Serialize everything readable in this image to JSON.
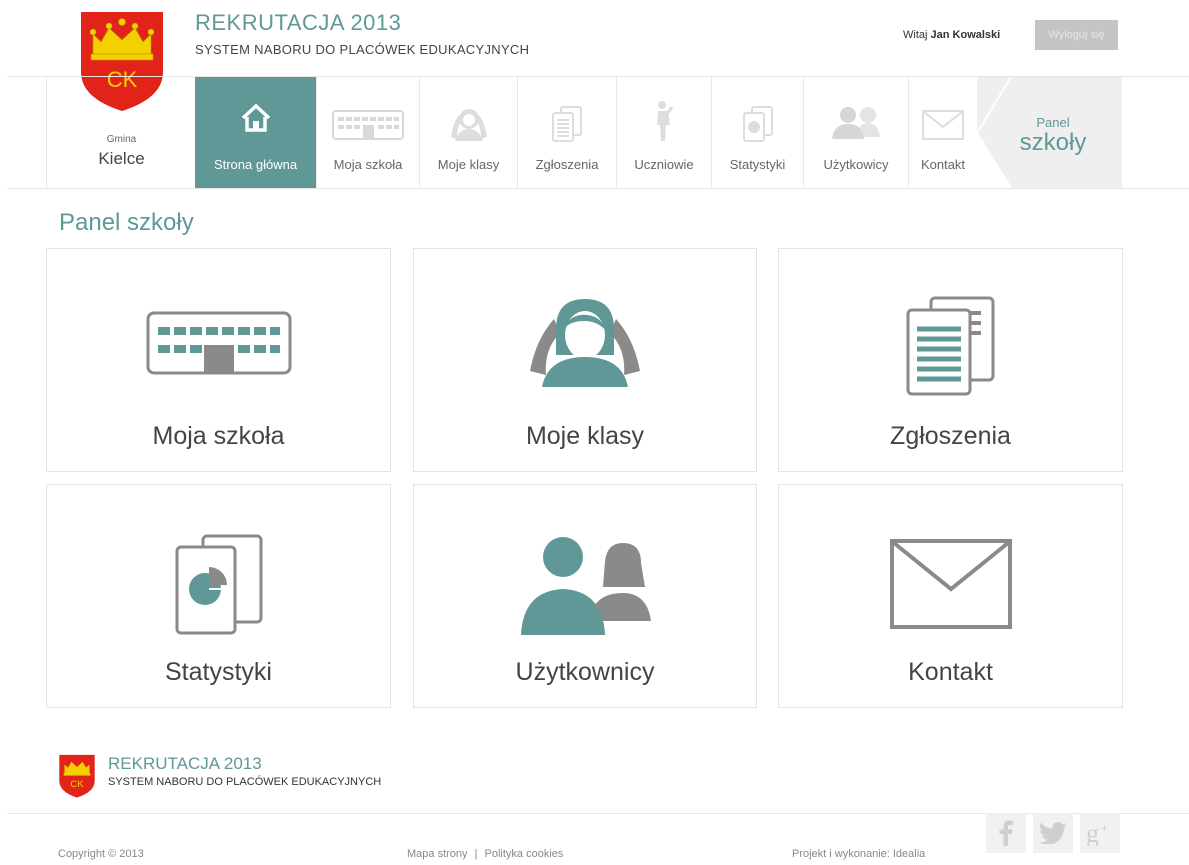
{
  "header": {
    "title": "REKRUTACJA 2013",
    "subtitle": "SYSTEM NABORU DO PLACÓWEK EDUKACYJNYCH",
    "welcome_prefix": "Witaj",
    "user_name": "Jan Kowalski",
    "logout_label": "Wyloguj się",
    "logo_text": "CK"
  },
  "nav": {
    "gmina_label": "Gmina",
    "gmina_name": "Kielce",
    "items": [
      {
        "label": "Strona główna",
        "icon": "home-icon"
      },
      {
        "label": "Moja szkoła",
        "icon": "school-icon"
      },
      {
        "label": "Moje klasy",
        "icon": "classes-icon"
      },
      {
        "label": "Zgłoszenia",
        "icon": "documents-icon"
      },
      {
        "label": "Uczniowie",
        "icon": "students-icon"
      },
      {
        "label": "Statystyki",
        "icon": "statistics-icon"
      },
      {
        "label": "Użytkowicy",
        "icon": "users-icon"
      },
      {
        "label": "Kontakt",
        "icon": "mail-icon"
      }
    ],
    "panel_small": "Panel",
    "panel_big": "szkoły"
  },
  "main": {
    "title": "Panel szkoły",
    "tiles": [
      {
        "label": "Moja szkoła",
        "icon": "school-icon"
      },
      {
        "label": "Moje klasy",
        "icon": "classes-icon"
      },
      {
        "label": "Zgłoszenia",
        "icon": "documents-icon"
      },
      {
        "label": "Statystyki",
        "icon": "statistics-icon"
      },
      {
        "label": "Użytkownicy",
        "icon": "users-icon"
      },
      {
        "label": "Kontakt",
        "icon": "mail-icon"
      }
    ]
  },
  "footer": {
    "title": "REKRUTACJA 2013",
    "subtitle": "SYSTEM NABORU DO PLACÓWEK EDUKACYJNYCH",
    "copyright": "Copyright © 2013",
    "link_sitemap": "Mapa strony",
    "link_separator": "|",
    "link_cookies": "Polityka cookies",
    "credit": "Projekt i wykonanie: Idealia",
    "social": [
      "f",
      "twitter",
      "g+"
    ]
  },
  "colors": {
    "accent": "#5f9896",
    "icon_grey": "#8a8a8a",
    "red": "#e2231a",
    "gold": "#f5d000"
  }
}
